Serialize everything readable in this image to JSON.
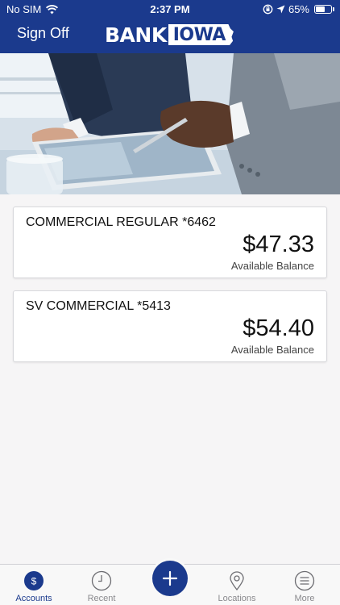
{
  "status_bar": {
    "carrier": "No SIM",
    "time": "2:37 PM",
    "battery_text": "65%",
    "battery_level": 0.65
  },
  "header": {
    "sign_off": "Sign Off",
    "logo_bank": "BANK",
    "logo_iowa": "IOWA"
  },
  "accounts": [
    {
      "name": "COMMERCIAL REGULAR *6462",
      "balance": "$47.33",
      "balance_label": "Available Balance"
    },
    {
      "name": "SV COMMERCIAL *5413",
      "balance": "$54.40",
      "balance_label": "Available Balance"
    }
  ],
  "tabbar": {
    "tabs": [
      {
        "label": "Accounts",
        "icon": "dollar-icon",
        "active": true
      },
      {
        "label": "Recent",
        "icon": "clock-icon",
        "active": false
      },
      {
        "label": "Locations",
        "icon": "map-pin-icon",
        "active": false
      },
      {
        "label": "More",
        "icon": "menu-icon",
        "active": false
      }
    ],
    "fab_icon": "plus-icon"
  },
  "colors": {
    "brand": "#1b3a8d",
    "background": "#f6f5f6",
    "inactive_tab": "#8a8a8e"
  }
}
